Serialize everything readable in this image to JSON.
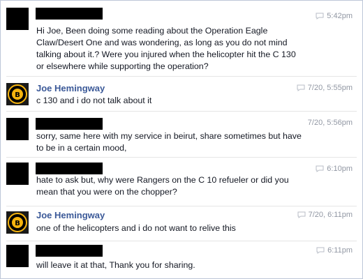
{
  "messages": [
    {
      "sender": "",
      "timestamp": "5:42pm",
      "text": "Hi Joe,  Been doing some reading about the Operation Eagle Claw/Desert One and was wondering, as long as you do not mind talking about it.?  Were you injured when the helicopter hit the C 130 or elsewhere while supporting the operation?"
    },
    {
      "sender": "Joe Hemingway",
      "timestamp": "7/20, 5:55pm",
      "text": "c 130 and i do not talk about it"
    },
    {
      "sender": "",
      "timestamp": "7/20, 5:56pm",
      "text": "sorry, same here with my service in beirut, share sometimes but have to be in a certain mood,"
    },
    {
      "sender": "",
      "timestamp": "6:10pm",
      "text": "hate to ask but, why were Rangers on the C 10 refueler or did you mean that you were on the chopper?"
    },
    {
      "sender": "Joe Hemingway",
      "timestamp": "7/20, 6:11pm",
      "text": "one of the helicopters and i do not want to relive this"
    },
    {
      "sender": "",
      "timestamp": "6:11pm",
      "text": "will leave it at that, Thank you for sharing."
    }
  ],
  "icons": {
    "timestamp_icon": "chat-bubble-icon",
    "avatar_logo": "bruins-logo-icon"
  },
  "colors": {
    "sender_name": "#3b5998",
    "timestamp": "#9197a3",
    "redaction": "#000000"
  }
}
